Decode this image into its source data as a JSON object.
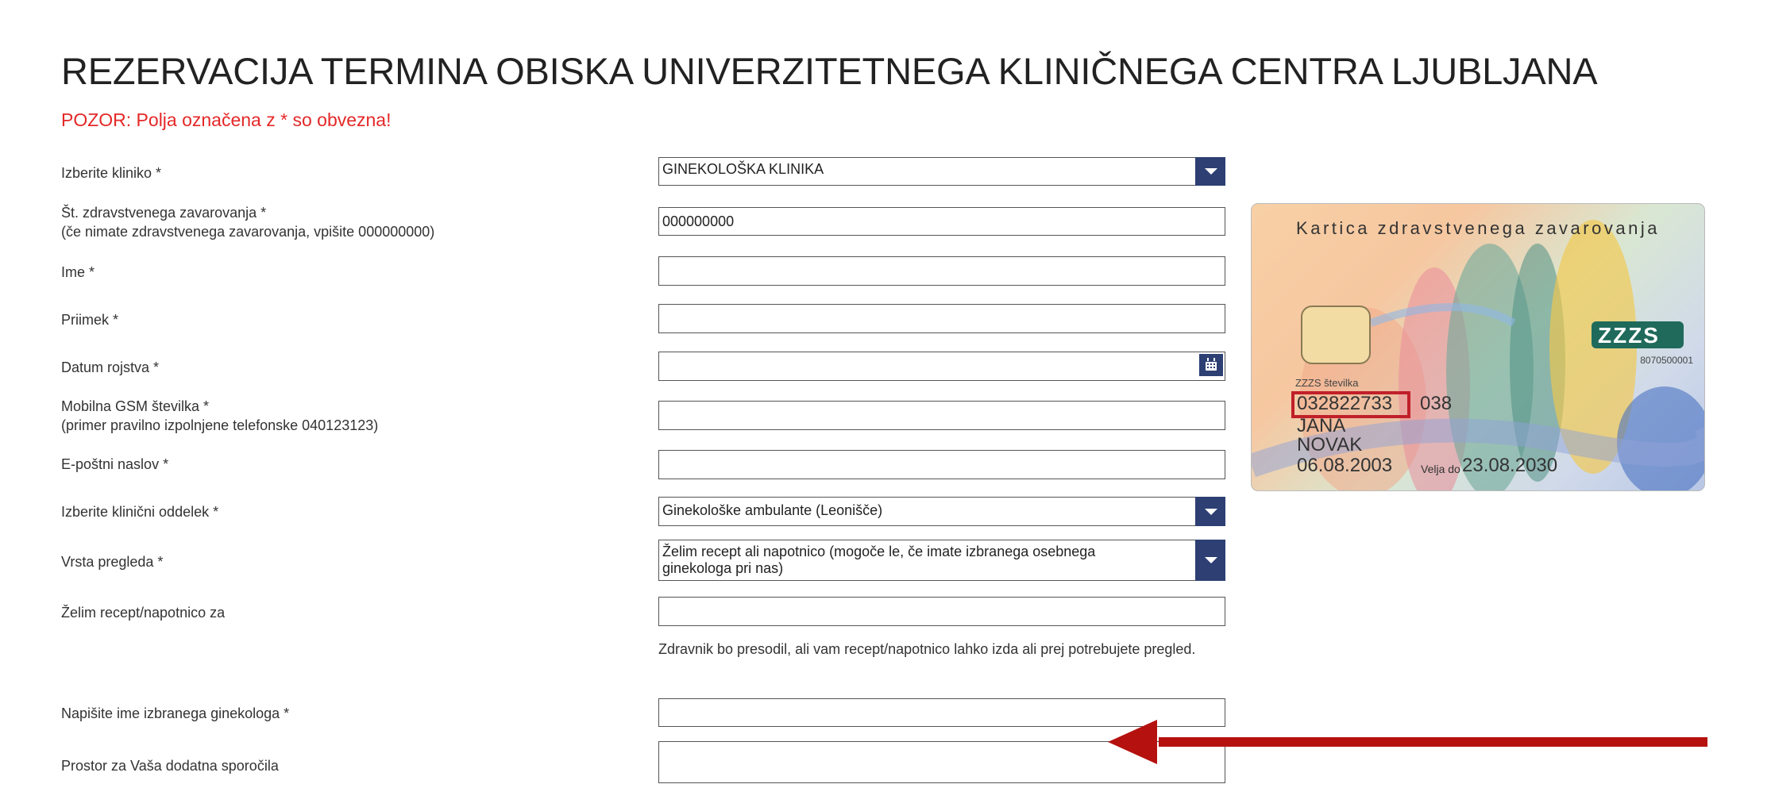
{
  "page": {
    "title": "REZERVACIJA TERMINA OBISKA UNIVERZITETNEGA KLINIČNEGA CENTRA LJUBLJANA",
    "warning": "POZOR: Polja označena z * so obvezna!"
  },
  "form": {
    "klinika_label": "Izberite kliniko *",
    "klinika_value": "GINEKOLOŠKA KLINIKA",
    "zavarovanje_label": "Št. zdravstvenega zavarovanja *",
    "zavarovanje_note": "(če nimate zdravstvenega zavarovanja, vpišite 000000000)",
    "zavarovanje_value": "000000000",
    "ime_label": "Ime *",
    "ime_value": "",
    "priimek_label": "Priimek *",
    "priimek_value": "",
    "datum_label": "Datum rojstva *",
    "datum_value": "",
    "gsm_label": "Mobilna GSM številka *",
    "gsm_note": "(primer pravilno izpolnjene telefonske 040123123)",
    "gsm_value": "",
    "email_label": "E-poštni naslov *",
    "email_value": "",
    "oddelek_label": "Izberite klinični oddelek *",
    "oddelek_value": "Ginekološke ambulante (Leonišče)",
    "vrsta_label": "Vrsta pregleda *",
    "vrsta_value": "Želim recept ali napotnico (mogoče le, če imate izbranega osebnega ginekologa pri nas)",
    "recept_label": "Želim recept/napotnico za",
    "recept_value": "",
    "recept_hint": "Zdravnik bo presodil, ali vam recept/napotnico lahko izda ali prej potrebujete pregled.",
    "ginekolog_label": "Napišite ime izbranega ginekologa *",
    "ginekolog_value": "",
    "sporocila_label": "Prostor za Vaša dodatna sporočila",
    "sporocila_value": ""
  },
  "card": {
    "title": "Kartica zdravstvenega zavarovanja",
    "logo_text": "ZZZS",
    "code": "8070500001",
    "number_label": "ZZZS številka",
    "number": "032822733",
    "number_suffix": "038",
    "name": "JANA",
    "surname": "NOVAK",
    "dob": "06.08.2003",
    "valid_label": "Velja do",
    "valid_until": "23.08.2030"
  },
  "colors": {
    "warning": "#e42828",
    "select_button": "#2d3f73",
    "card_highlight": "#c0202a",
    "arrow": "#b5120f"
  },
  "icons": {
    "dropdown": "chevron-down-icon",
    "calendar": "calendar-icon",
    "pointer": "arrow-left-icon"
  }
}
